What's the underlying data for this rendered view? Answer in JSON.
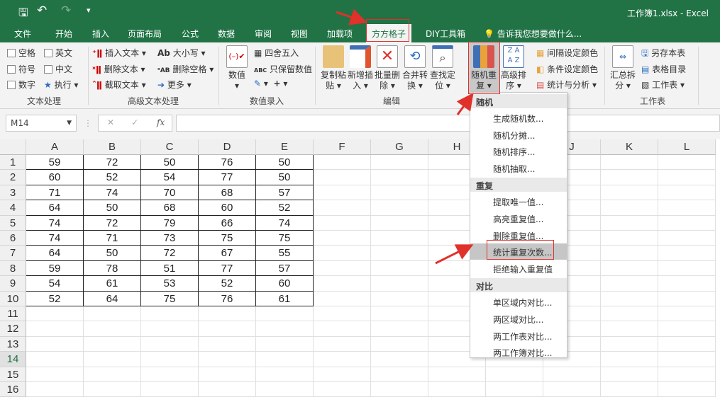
{
  "title_bar": {
    "quick_access": [
      "save-icon",
      "undo-icon",
      "redo-icon",
      "customize-icon"
    ],
    "title": "工作簿1.xlsx - Excel"
  },
  "tabs": [
    "文件",
    "开始",
    "插入",
    "页面布局",
    "公式",
    "数据",
    "审阅",
    "视图",
    "加载项",
    "方方格子",
    "DIY工具箱"
  ],
  "tell_me": "告诉我您想要做什么...",
  "ribbon": {
    "text_group": {
      "checkboxes": [
        "空格",
        "英文",
        "符号",
        "中文",
        "数字"
      ],
      "exec": "执行",
      "label": "文本处理"
    },
    "adv_text_group": {
      "items": [
        "插入文本",
        "删除文本",
        "截取文本",
        "大小写",
        "删除空格",
        "更多"
      ],
      "label": "高级文本处理"
    },
    "num_group": {
      "big": "数值",
      "items": [
        "四舍五入",
        "只保留数值"
      ],
      "label": "数值录入"
    },
    "edit_group": {
      "buttons": [
        [
          "复制粘",
          "贴"
        ],
        [
          "新增插",
          "入"
        ],
        [
          "批量删",
          "除"
        ],
        [
          "合并转",
          "换"
        ],
        [
          "查找定",
          "位"
        ],
        [
          "随机重",
          "复"
        ],
        [
          "高级排",
          "序"
        ]
      ],
      "label": "编辑"
    },
    "color_items": [
      "间隔设定颜色",
      "条件设定颜色",
      "统计与分析"
    ],
    "sheet_group": {
      "big": [
        "汇总拆",
        "分"
      ],
      "items": [
        "另存本表",
        "表格目录",
        "工作表"
      ],
      "label": "工作表"
    }
  },
  "formula_bar": {
    "name_box": "M14",
    "fx": "fx",
    "value": ""
  },
  "columns": [
    "A",
    "B",
    "C",
    "D",
    "E",
    "F",
    "G",
    "H",
    "I",
    "J",
    "K",
    "L"
  ],
  "rows": [
    "1",
    "2",
    "3",
    "4",
    "5",
    "6",
    "7",
    "8",
    "9",
    "10",
    "11",
    "12",
    "13",
    "14",
    "15",
    "16"
  ],
  "cells": [
    [
      "59",
      "72",
      "50",
      "76",
      "50"
    ],
    [
      "60",
      "52",
      "54",
      "77",
      "50"
    ],
    [
      "71",
      "74",
      "70",
      "68",
      "57"
    ],
    [
      "64",
      "50",
      "68",
      "60",
      "52"
    ],
    [
      "74",
      "72",
      "79",
      "66",
      "74"
    ],
    [
      "74",
      "71",
      "73",
      "75",
      "75"
    ],
    [
      "64",
      "50",
      "72",
      "67",
      "55"
    ],
    [
      "59",
      "78",
      "51",
      "77",
      "57"
    ],
    [
      "54",
      "61",
      "53",
      "52",
      "60"
    ],
    [
      "52",
      "64",
      "75",
      "76",
      "61"
    ]
  ],
  "menu": {
    "sections": [
      {
        "header": "随机",
        "items": [
          "生成随机数...",
          "随机分摊...",
          "随机排序...",
          "随机抽取..."
        ]
      },
      {
        "header": "重复",
        "items": [
          "提取唯一值...",
          "高亮重复值...",
          "删除重复值...",
          "统计重复次数...",
          "拒绝输入重复值"
        ]
      },
      {
        "header": "对比",
        "items": [
          "单区域内对比...",
          "两区域对比...",
          "两工作表对比...",
          "两工作簿对比..."
        ]
      }
    ],
    "highlighted": "统计重复次数..."
  },
  "colors": {
    "excel_green": "#217346",
    "annotation_red": "#e0312a",
    "menu_highlight": "#c6c6c6"
  }
}
